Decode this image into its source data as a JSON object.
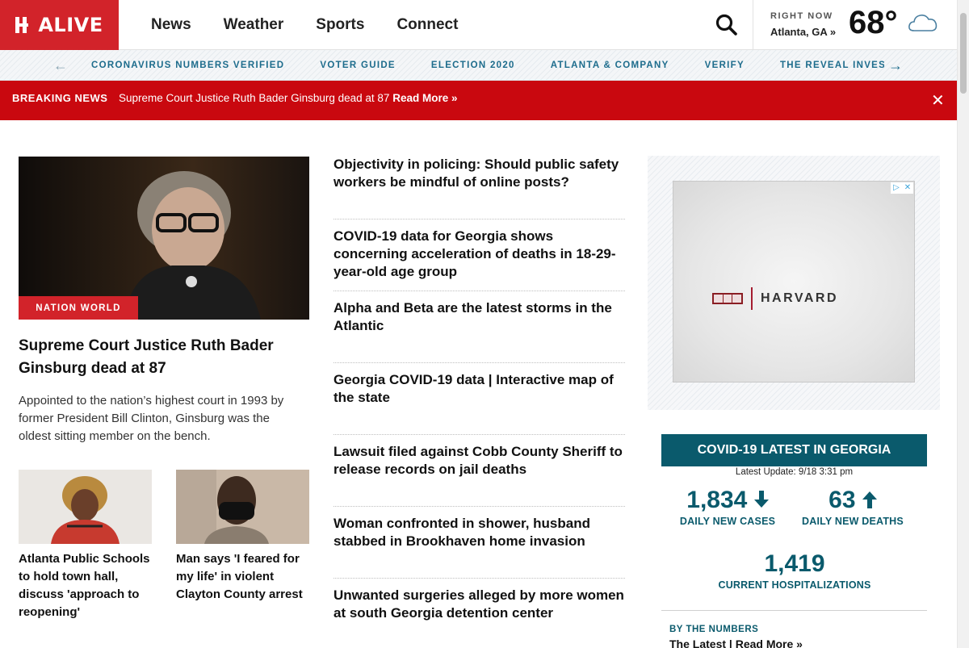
{
  "header": {
    "logo_text": "ALIVE",
    "nav": [
      "News",
      "Weather",
      "Sports",
      "Connect"
    ],
    "weather": {
      "right_now": "RIGHT NOW",
      "location": "Atlanta, GA »",
      "temp": "68°"
    }
  },
  "subnav": {
    "links": [
      "CORONAVIRUS NUMBERS VERIFIED",
      "VOTER GUIDE",
      "ELECTION 2020",
      "ATLANTA & COMPANY",
      "VERIFY",
      "THE REVEAL INVESTIGATES"
    ]
  },
  "breaking": {
    "label": "BREAKING NEWS",
    "message": "Supreme Court Justice Ruth Bader Ginsburg dead at 87",
    "read_more": "Read More »"
  },
  "lead": {
    "tag": "NATION WORLD",
    "title": "Supreme Court Justice Ruth Bader Ginsburg dead at 87",
    "description": "Appointed to the nation’s highest court in 1993 by former President Bill Clinton, Ginsburg was the oldest sitting member on the bench."
  },
  "small_stories": [
    {
      "title": "Atlanta Public Schools to hold town hall, discuss 'approach to reopening'"
    },
    {
      "title": "Man says 'I feared for my life' in violent Clayton County arrest"
    }
  ],
  "headlines": [
    "Objectivity in policing: Should public safety workers be mindful of online posts?",
    "COVID-19 data for Georgia shows concerning acceleration of deaths in 18-29-year-old age group",
    "Alpha and Beta are the latest storms in the Atlantic",
    "Georgia COVID-19 data | Interactive map of the state",
    "Lawsuit filed against Cobb County Sheriff to release records on jail deaths",
    "Woman confronted in shower, husband stabbed in Brookhaven home invasion",
    "Unwanted surgeries alleged by more women at south Georgia detention center"
  ],
  "ad": {
    "brand": "HARVARD"
  },
  "covid": {
    "title": "COVID-19 LATEST IN GEORGIA",
    "updated": "Latest Update: 9/18 3:31 pm",
    "cases": "1,834",
    "cases_label": "DAILY NEW CASES",
    "deaths": "63",
    "deaths_label": "DAILY NEW DEATHS",
    "hosp": "1,419",
    "hosp_label": "CURRENT HOSPITALIZATIONS",
    "by_numbers": "BY THE NUMBERS",
    "latest": "The Latest | Read More »"
  },
  "colors": {
    "brand_red": "#d2232a",
    "breaking_red": "#c9080f",
    "teal": "#0a5a6c",
    "link_blue": "#1d6c8c"
  }
}
